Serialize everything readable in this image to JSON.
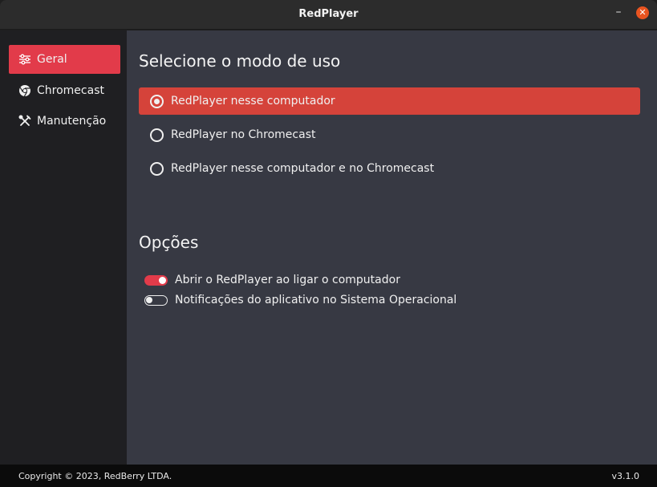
{
  "window": {
    "title": "RedPlayer",
    "minimize_glyph": "–",
    "close_glyph": "✕",
    "close_color": "#e95420"
  },
  "sidebar": {
    "items": [
      {
        "label": "Geral",
        "icon": "sliders-icon",
        "active": true
      },
      {
        "label": "Chromecast",
        "icon": "chrome-icon",
        "active": false
      },
      {
        "label": "Manutenção",
        "icon": "tools-icon",
        "active": false
      }
    ]
  },
  "main": {
    "mode_title": "Selecione o modo de uso",
    "modes": [
      {
        "label": "RedPlayer nesse computador",
        "selected": true
      },
      {
        "label": "RedPlayer no Chromecast",
        "selected": false
      },
      {
        "label": "RedPlayer nesse computador e no Chromecast",
        "selected": false
      }
    ],
    "options_title": "Opções",
    "options": [
      {
        "label": "Abrir o RedPlayer ao ligar o computador",
        "enabled": true
      },
      {
        "label": "Notificações do aplicativo no Sistema Operacional",
        "enabled": false
      }
    ]
  },
  "footer": {
    "copyright": "Copyright © 2023, RedBerry LTDA.",
    "version": "v3.1.0"
  },
  "colors": {
    "accent": "#e23b4a",
    "selected_row": "#d5433a",
    "main_bg": "#373943",
    "sidebar_bg": "#1f1f22"
  }
}
